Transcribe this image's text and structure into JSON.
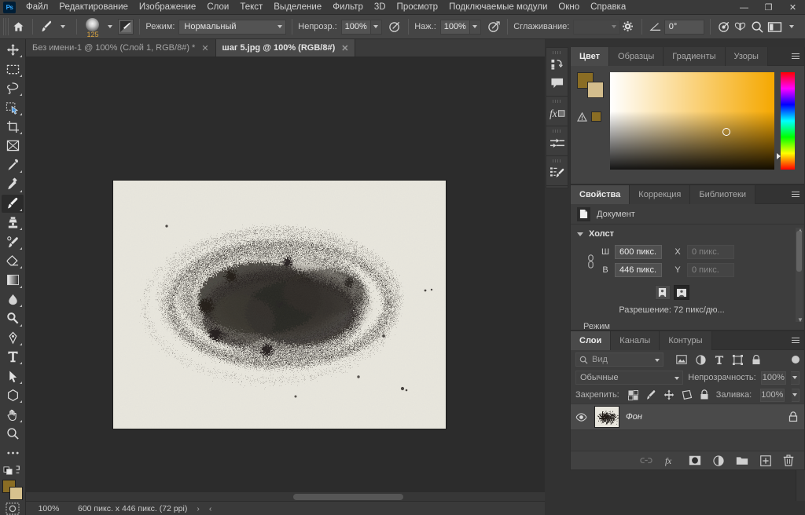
{
  "app": {
    "logo": "ps-logo",
    "menus": [
      "Файл",
      "Редактирование",
      "Изображение",
      "Слои",
      "Текст",
      "Выделение",
      "Фильтр",
      "3D",
      "Просмотр",
      "Подключаемые модули",
      "Окно",
      "Справка"
    ],
    "window_controls": [
      {
        "name": "minimize-button",
        "glyph": "—"
      },
      {
        "name": "restore-button",
        "glyph": "❐"
      },
      {
        "name": "close-button",
        "glyph": "✕"
      }
    ]
  },
  "options_bar": {
    "home_icon": "home-icon",
    "tool_icon": "brush-tool-icon",
    "brush_size": "125",
    "brush_chip_icon": "brush-preset-icon",
    "mode_label": "Режим:",
    "mode_value": "Нормальный",
    "opacity_label": "Непрозр.:",
    "opacity_value": "100%",
    "pressure_opacity_icon": "pressure-opacity-icon",
    "flow_label": "Наж.:",
    "flow_value": "100%",
    "airbrush_icon": "airbrush-icon",
    "smoothing_label": "Сглаживание:",
    "smoothing_value": "",
    "smoothing_gear_icon": "gear-icon",
    "angle_icon": "brush-angle-icon",
    "angle_value": "0°",
    "pressure_size_icon": "pressure-size-icon",
    "symmetry_icon": "symmetry-butterfly-icon",
    "search_icon": "search-icon",
    "workspace_icon": "workspace-switcher-icon"
  },
  "tabs": [
    {
      "label": "Без имени-1 @ 100% (Слой 1, RGB/8#) *",
      "active": false,
      "close": "✕"
    },
    {
      "label": "шаг 5.jpg @ 100% (RGB/8#)",
      "active": true,
      "close": "✕"
    }
  ],
  "toolbar": {
    "tools": [
      {
        "name": "move-tool",
        "icon": "move-icon",
        "active": false,
        "more": true
      },
      {
        "name": "rectangular-marquee-tool",
        "icon": "marquee-icon",
        "active": false,
        "more": true
      },
      {
        "name": "lasso-tool",
        "icon": "lasso-icon",
        "active": false,
        "more": true
      },
      {
        "name": "quick-selection-tool",
        "icon": "quick-select-icon",
        "active": false,
        "more": true
      },
      {
        "name": "crop-tool",
        "icon": "crop-icon",
        "active": false,
        "more": true
      },
      {
        "name": "frame-tool",
        "icon": "frame-icon",
        "active": false,
        "more": false
      },
      {
        "name": "eyedropper-tool",
        "icon": "eyedropper-icon",
        "active": false,
        "more": true
      },
      {
        "name": "healing-brush-tool",
        "icon": "healing-brush-icon",
        "active": false,
        "more": true
      },
      {
        "name": "brush-tool",
        "icon": "brush-icon",
        "active": true,
        "more": true
      },
      {
        "name": "clone-stamp-tool",
        "icon": "clone-stamp-icon",
        "active": false,
        "more": true
      },
      {
        "name": "history-brush-tool",
        "icon": "history-brush-icon",
        "active": false,
        "more": true
      },
      {
        "name": "eraser-tool",
        "icon": "eraser-icon",
        "active": false,
        "more": true
      },
      {
        "name": "gradient-tool",
        "icon": "gradient-icon",
        "active": false,
        "more": true
      },
      {
        "name": "blur-tool",
        "icon": "blur-drop-icon",
        "active": false,
        "more": true
      },
      {
        "name": "dodge-tool",
        "icon": "dodge-icon",
        "active": false,
        "more": true
      },
      {
        "name": "pen-tool",
        "icon": "pen-icon",
        "active": false,
        "more": true
      },
      {
        "name": "type-tool",
        "icon": "type-T-icon",
        "active": false,
        "more": true
      },
      {
        "name": "path-selection-tool",
        "icon": "path-arrow-icon",
        "active": false,
        "more": true
      },
      {
        "name": "shape-tool",
        "icon": "polygon-icon",
        "active": false,
        "more": true
      },
      {
        "name": "hand-tool",
        "icon": "hand-icon",
        "active": false,
        "more": true
      },
      {
        "name": "zoom-tool",
        "icon": "magnifier-icon",
        "active": false,
        "more": false
      }
    ],
    "more_tools_icon": "ellipsis-icon",
    "default-colors-icon": "default-colors-icon",
    "swap-colors-icon": "swap-colors-icon",
    "foreground_color": "#8a6d24",
    "background_color": "#d8c28e",
    "quick_mask_icon": "quick-mask-icon"
  },
  "canvas": {
    "paper_color": "#e8e6dd",
    "ink_color": "#2f2c28",
    "backdrop_color": "#2c2c2c"
  },
  "status_bar": {
    "zoom": "100%",
    "dimensions": "600 пикс. x 446 пикс. (72 ppi)",
    "expand_glyph": "›",
    "collapse_glyph": "‹"
  },
  "dock_rail": {
    "icons": [
      {
        "name": "history-icon"
      },
      {
        "name": "comments-icon"
      },
      {
        "name": "layer-styles-fx-icon"
      },
      {
        "name": "adjustments-icon"
      },
      {
        "name": "brush-settings-icon"
      }
    ]
  },
  "color_panel": {
    "tabs": [
      {
        "label": "Цвет",
        "active": true
      },
      {
        "label": "Образцы",
        "active": false
      },
      {
        "label": "Градиенты",
        "active": false
      },
      {
        "label": "Узоры",
        "active": false
      }
    ],
    "menu_icon": "panel-menu-icon",
    "foreground_color": "#8a6d24",
    "background_color": "#d3bd8c",
    "warning_icon": "out-of-gamut-warning-icon",
    "warning_color": "#8a6d24",
    "field_base_color": "#f5a800",
    "picker_icon": "color-picker-ring"
  },
  "properties_panel": {
    "tabs": [
      {
        "label": "Свойства",
        "active": true
      },
      {
        "label": "Коррекция",
        "active": false
      },
      {
        "label": "Библиотеки",
        "active": false
      }
    ],
    "menu_icon": "panel-menu-icon",
    "header_icon": "document-icon",
    "header_label": "Документ",
    "section_label": "Холст",
    "link_icon": "link-dimensions-icon",
    "width_label": "Ш",
    "width_value": "600 пикс.",
    "height_label": "В",
    "height_value": "446 пикс.",
    "x_label": "X",
    "x_value": "0 пикс.",
    "y_label": "Y",
    "y_value": "0 пикс.",
    "orientation": [
      {
        "name": "portrait-orientation-button",
        "selected": false
      },
      {
        "name": "landscape-orientation-button",
        "selected": true
      }
    ],
    "resolution_text": "Разрешение: 72 пикс/дю...",
    "mode_label": "Режим"
  },
  "layers_panel": {
    "tabs": [
      {
        "label": "Слои",
        "active": true
      },
      {
        "label": "Каналы",
        "active": false
      },
      {
        "label": "Контуры",
        "active": false
      }
    ],
    "menu_icon": "panel-menu-icon",
    "filter_icon": "search-icon",
    "filter_value": "Вид",
    "filter_icons": [
      {
        "name": "filter-pixel-icon"
      },
      {
        "name": "filter-adjustment-icon"
      },
      {
        "name": "filter-type-icon"
      },
      {
        "name": "filter-shape-icon"
      },
      {
        "name": "filter-smart-object-icon"
      }
    ],
    "filter_toggle_icon": "filter-toggle-switch",
    "blend_mode": "Обычные",
    "opacity_label": "Непрозрачность:",
    "opacity_value": "100%",
    "lock_label": "Закрепить:",
    "lock_icons": [
      {
        "name": "lock-transparency-icon"
      },
      {
        "name": "lock-image-icon"
      },
      {
        "name": "lock-position-icon"
      },
      {
        "name": "lock-artboard-icon"
      },
      {
        "name": "lock-all-icon"
      }
    ],
    "fill_label": "Заливка:",
    "fill_value": "100%",
    "layers": [
      {
        "name": "Фон",
        "visible": true,
        "locked": true,
        "eye_icon": "eye-icon",
        "lock_icon": "lock-icon"
      }
    ],
    "footer_icons": [
      {
        "name": "link-layers-icon"
      },
      {
        "name": "layer-style-fx-icon"
      },
      {
        "name": "add-mask-icon"
      },
      {
        "name": "new-adjustment-layer-icon"
      },
      {
        "name": "new-group-icon"
      },
      {
        "name": "new-layer-icon"
      },
      {
        "name": "delete-layer-icon"
      }
    ]
  }
}
